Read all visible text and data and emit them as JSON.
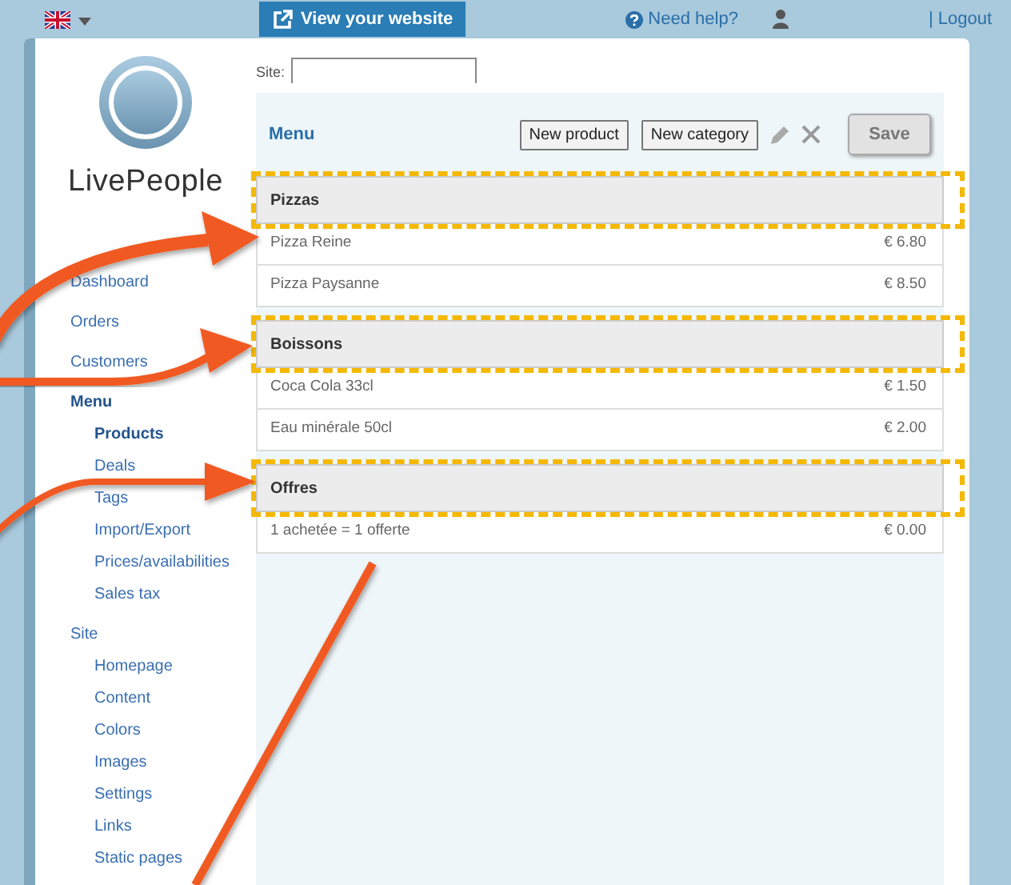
{
  "top_bar": {
    "website_button": "View your website",
    "help": "Need help?",
    "logout": "| Logout"
  },
  "logo": {
    "text": "LivePeople"
  },
  "sidebar": {
    "items": [
      {
        "label": "Dashboard",
        "selected": false
      },
      {
        "label": "Orders",
        "selected": false
      },
      {
        "label": "Customers",
        "selected": false
      },
      {
        "label": "Menu",
        "selected": true,
        "children": [
          {
            "label": "Products",
            "selected": true
          },
          {
            "label": "Deals",
            "selected": false
          },
          {
            "label": "Tags",
            "selected": false
          },
          {
            "label": "Import/Export",
            "selected": false
          },
          {
            "label": "Prices/availabilities",
            "selected": false
          },
          {
            "label": "Sales tax",
            "selected": false
          }
        ]
      },
      {
        "label": "Site",
        "selected": false,
        "children": [
          {
            "label": "Homepage",
            "selected": false
          },
          {
            "label": "Content",
            "selected": false
          },
          {
            "label": "Colors",
            "selected": false
          },
          {
            "label": "Images",
            "selected": false
          },
          {
            "label": "Settings",
            "selected": false
          },
          {
            "label": "Links",
            "selected": false
          },
          {
            "label": "Static pages",
            "selected": false
          }
        ]
      }
    ]
  },
  "site_field": {
    "label": "Site:"
  },
  "menu_panel": {
    "title": "Menu",
    "buttons": [
      "New product",
      "New category"
    ],
    "save": {
      "label": "Save",
      "disabled": true
    },
    "categories": [
      {
        "name": "Pizzas",
        "highlighted": true,
        "products": [
          {
            "name": "Pizza Reine",
            "price": "€ 6.80"
          },
          {
            "name": "Pizza Paysanne",
            "price": "€ 8.50"
          }
        ]
      },
      {
        "name": "Boissons",
        "highlighted": true,
        "products": [
          {
            "name": "Coca Cola 33cl",
            "price": "€ 1.50"
          },
          {
            "name": "Eau minérale 50cl",
            "price": "€ 2.00"
          }
        ]
      },
      {
        "name": "Offres",
        "highlighted": true,
        "products": [
          {
            "name": "1 achetée = 1 offerte",
            "price": "€ 0.00"
          }
        ]
      }
    ]
  }
}
